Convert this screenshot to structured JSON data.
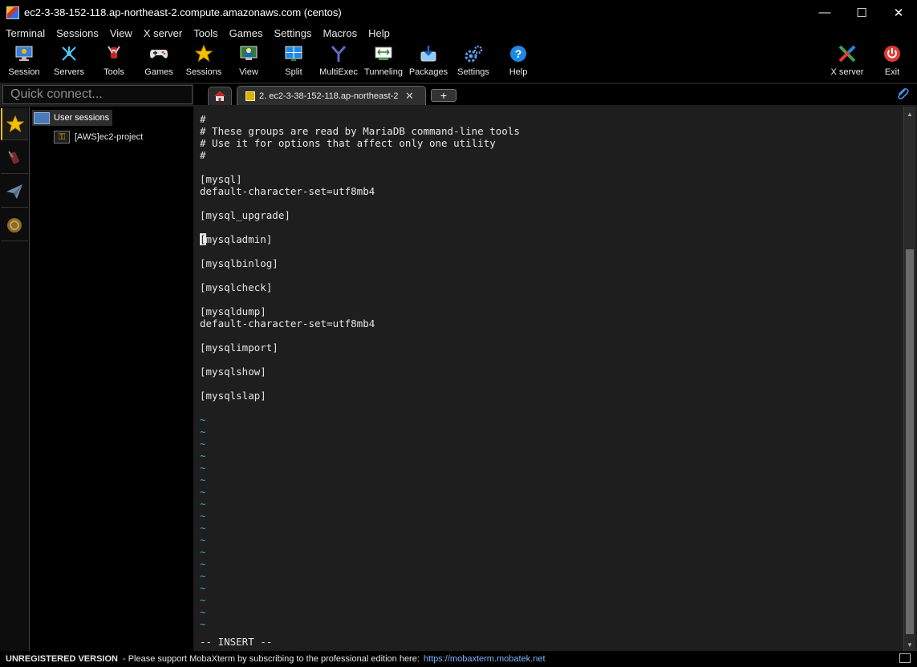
{
  "window": {
    "title": "ec2-3-38-152-118.ap-northeast-2.compute.amazonaws.com (centos)",
    "minimize": "—",
    "maximize": "☐",
    "close": "✕"
  },
  "menu": [
    "Terminal",
    "Sessions",
    "View",
    "X server",
    "Tools",
    "Games",
    "Settings",
    "Macros",
    "Help"
  ],
  "toolbar": {
    "session": "Session",
    "servers": "Servers",
    "tools": "Tools",
    "games": "Games",
    "sessions": "Sessions",
    "view": "View",
    "split": "Split",
    "multiexec": "MultiExec",
    "tunneling": "Tunneling",
    "packages": "Packages",
    "settings": "Settings",
    "help": "Help",
    "xserver": "X server",
    "exit": "Exit"
  },
  "quick_connect": {
    "placeholder": "Quick connect..."
  },
  "tabs": {
    "session_tab_label": "2. ec2-3-38-152-118.ap-northeast-2",
    "close": "✕",
    "new": "+"
  },
  "sidebar": {
    "root": "User sessions",
    "child": "[AWS]ec2-project"
  },
  "terminal": {
    "lines": [
      "#",
      "# These groups are read by MariaDB command-line tools",
      "# Use it for options that affect only one utility",
      "#",
      "",
      "[mysql]",
      "default-character-set=utf8mb4",
      "",
      "[mysql_upgrade]",
      "",
      "[mysqladmin]",
      "",
      "[mysqlbinlog]",
      "",
      "[mysqlcheck]",
      "",
      "[mysqldump]",
      "default-character-set=utf8mb4",
      "",
      "[mysqlimport]",
      "",
      "[mysqlshow]",
      "",
      "[mysqlslap]",
      "",
      "~",
      "~",
      "~",
      "~",
      "~",
      "~",
      "~",
      "~",
      "~",
      "~",
      "~",
      "~",
      "~",
      "~",
      "~",
      "~",
      "~",
      "~",
      "-- INSERT --"
    ],
    "cursor_line": 10
  },
  "status": {
    "unregistered": "UNREGISTERED VERSION",
    "message": "-  Please support MobaXterm by subscribing to the professional edition here:",
    "link": "https://mobaxterm.mobatek.net"
  },
  "colors": {
    "terminal_bg": "#1e1e1e",
    "tilde": "#3fa9d1",
    "link": "#7fb4ff",
    "accent": "#f0c000"
  }
}
